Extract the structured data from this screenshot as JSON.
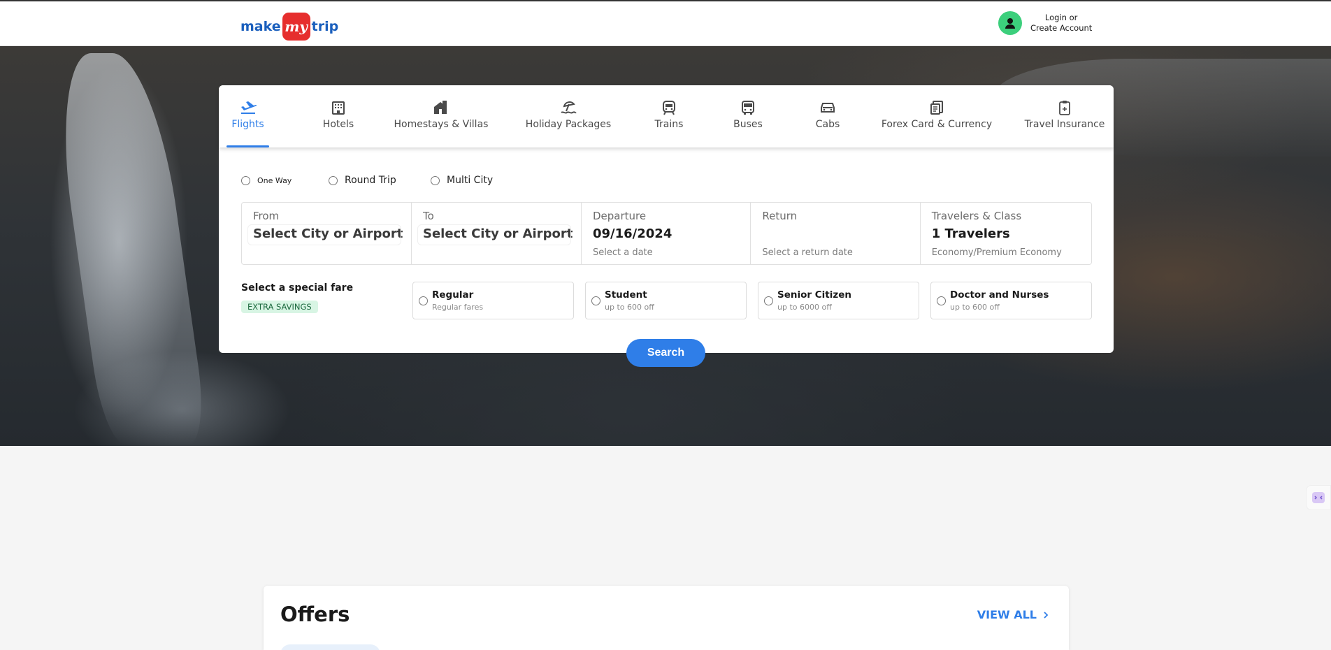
{
  "header": {
    "logo": {
      "make": "make",
      "my": "my",
      "trip": "trip"
    },
    "login_line1": "Login or",
    "login_line2": "Create Account"
  },
  "tabs": [
    {
      "label": "Flights",
      "icon": "plane-icon",
      "active": true
    },
    {
      "label": "Hotels",
      "icon": "hotel-icon"
    },
    {
      "label": "Homestays & Villas",
      "icon": "homestay-icon"
    },
    {
      "label": "Holiday Packages",
      "icon": "beach-umbrella-icon"
    },
    {
      "label": "Trains",
      "icon": "train-icon"
    },
    {
      "label": "Buses",
      "icon": "bus-icon"
    },
    {
      "label": "Cabs",
      "icon": "cab-icon"
    },
    {
      "label": "Forex Card & Currency",
      "icon": "forex-icon"
    },
    {
      "label": "Travel Insurance",
      "icon": "insurance-icon"
    }
  ],
  "trip_types": [
    {
      "label": "One Way"
    },
    {
      "label": "Round Trip"
    },
    {
      "label": "Multi City"
    }
  ],
  "fields": {
    "from": {
      "label": "From",
      "value": "Select City or Airport"
    },
    "to": {
      "label": "To",
      "value": "Select City or Airport"
    },
    "departure": {
      "label": "Departure",
      "value": "09/16/2024",
      "sub": "Select a date"
    },
    "return": {
      "label": "Return",
      "value": "",
      "sub": "Select a return date"
    },
    "travelers": {
      "label": "Travelers & Class",
      "value": "1 Travelers",
      "sub": "Economy/Premium Economy"
    }
  },
  "special_fare": {
    "title": "Select a special fare",
    "badge": "EXTRA SAVINGS",
    "options": [
      {
        "name": "Regular",
        "sub": "Regular fares"
      },
      {
        "name": "Student",
        "sub": "up to 600 off"
      },
      {
        "name": "Senior Citizen",
        "sub": "up to 6000 off"
      },
      {
        "name": "Doctor and Nurses",
        "sub": "up to 600 off"
      }
    ]
  },
  "search_label": "Search",
  "offers": {
    "title": "Offers",
    "view_all": "VIEW ALL"
  },
  "colors": {
    "accent": "#2f7ee8",
    "brand_red": "#e62e2d",
    "brand_blue": "#1a5fbd",
    "badge_bg": "#d8f5e4"
  }
}
